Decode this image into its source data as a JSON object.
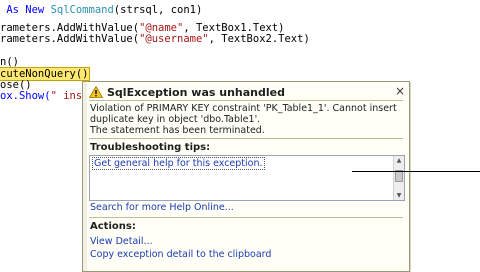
{
  "code": {
    "line1_a": " As New ",
    "line1_b": "SqlCommand",
    "line1_c": "(strsql, con1)",
    "line2_a": "rameters.AddWithValue(",
    "line2_b": "\"@name\"",
    "line2_c": ", TextBox1.Text)",
    "line3_a": "rameters.AddWithValue(",
    "line3_b": "\"@username\"",
    "line3_c": ", TextBox2.Text)",
    "line4": "n()",
    "line5": "cuteNonQuery",
    "line5_b": "()",
    "line6": "ose()",
    "line7_a": "ox.Show(",
    "line7_b": "\" inser"
  },
  "dialog": {
    "title": "SqlException was unhandled",
    "close_label": "×",
    "message": "Violation of PRIMARY KEY constraint 'PK_Table1_1'. Cannot insert duplicate key in object 'dbo.Table1'.",
    "message2": "The statement has been terminated.",
    "tips_heading": "Troubleshooting tips:",
    "tip_link": "Get general help for this exception.",
    "search_link": "Search for more Help Online...",
    "actions_heading": "Actions:",
    "view_detail": "View Detail...",
    "copy_detail": "Copy exception detail to the clipboard"
  },
  "icons": {
    "warning": "warning-icon"
  },
  "colors": {
    "keyword": "#0000ff",
    "type": "#2b91af",
    "string": "#a31515",
    "link": "#1c3cb0"
  }
}
